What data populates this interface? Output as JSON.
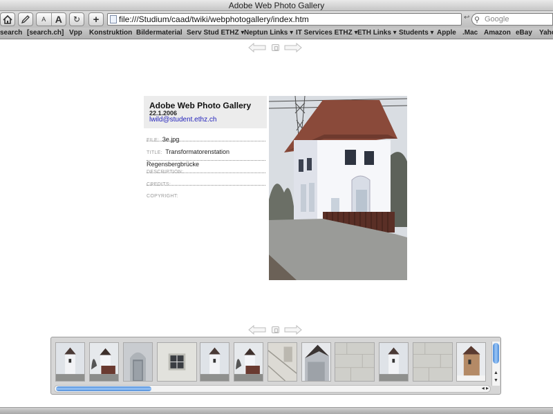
{
  "window": {
    "title": "Adobe Web Photo Gallery"
  },
  "toolbar": {
    "url": "file:///Studium/caad/twiki/webphotogallery/index.htm",
    "search_placeholder": "Google",
    "font_small_label": "A",
    "font_large_label": "A",
    "snapback_label": "↩",
    "add_label": "+",
    "reload_label": "↻"
  },
  "bookmarks": [
    {
      "label": "search"
    },
    {
      "label": "[search.ch]"
    },
    {
      "label": "Vpp"
    },
    {
      "label": "Konstruktion"
    },
    {
      "label": "Bildermaterial"
    },
    {
      "label": "Serv Stud ETHZ ▾"
    },
    {
      "label": "Neptun Links ▾"
    },
    {
      "label": "IT Services ETHZ ▾"
    },
    {
      "label": "ETH Links ▾"
    },
    {
      "label": "Students ▾"
    },
    {
      "label": "Apple"
    },
    {
      "label": ".Mac"
    },
    {
      "label": "Amazon"
    },
    {
      "label": "eBay"
    },
    {
      "label": "Yaho"
    }
  ],
  "gallery": {
    "title": "Adobe Web Photo Gallery",
    "date": "22.1.2006",
    "email": "lwild@student.ethz.ch"
  },
  "fields": {
    "file_label": "FILE:",
    "file_value": "3e.jpg",
    "title_label": "TITLE:",
    "title_value": "Transformatorenstation Regensbergbrücke",
    "description_label": "DESCRIPTION:",
    "credits_label": "CREDITS:",
    "copyright_label": "COPYRIGHT:"
  },
  "colors": {
    "link": "#2222bb",
    "scroll_accent": "#4c8bd8"
  },
  "filmstrip": {
    "thumbnails": [
      {
        "kind": "tower"
      },
      {
        "kind": "tower-tree"
      },
      {
        "kind": "door"
      },
      {
        "kind": "window"
      },
      {
        "kind": "tower"
      },
      {
        "kind": "tower-tree"
      },
      {
        "kind": "wall-detail"
      },
      {
        "kind": "roof-angle"
      },
      {
        "kind": "stone"
      },
      {
        "kind": "tower"
      },
      {
        "kind": "stone"
      },
      {
        "kind": "tower-snow"
      }
    ],
    "scroll_position": 0
  }
}
